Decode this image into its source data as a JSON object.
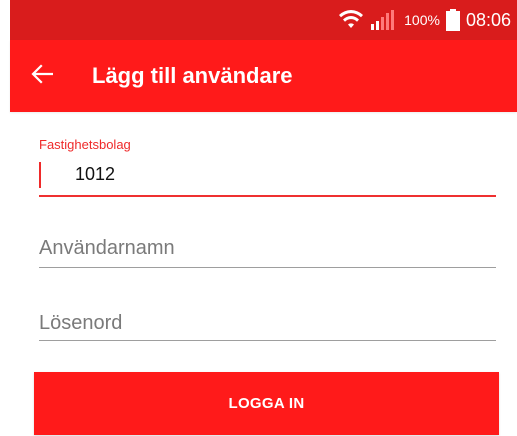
{
  "status_bar": {
    "battery_percent": "100%",
    "time": "08:06",
    "icons": [
      "wifi-icon",
      "signal-icon",
      "battery-icon"
    ]
  },
  "app_bar": {
    "back_icon": "arrow-left-icon",
    "title": "Lägg till användare"
  },
  "form": {
    "company_field": {
      "label": "Fastighetsbolag",
      "value": "1012",
      "focused": true
    },
    "username_field": {
      "placeholder": "Användarnamn",
      "value": ""
    },
    "password_field": {
      "placeholder": "Lösenord",
      "value": ""
    },
    "login_button_label": "LOGGA IN"
  },
  "colors": {
    "status_bar": "#d91c1c",
    "primary": "#ff1a1a",
    "accent": "#ef2a2a",
    "placeholder": "#7a7a7a",
    "underline": "#9e9e9e"
  }
}
